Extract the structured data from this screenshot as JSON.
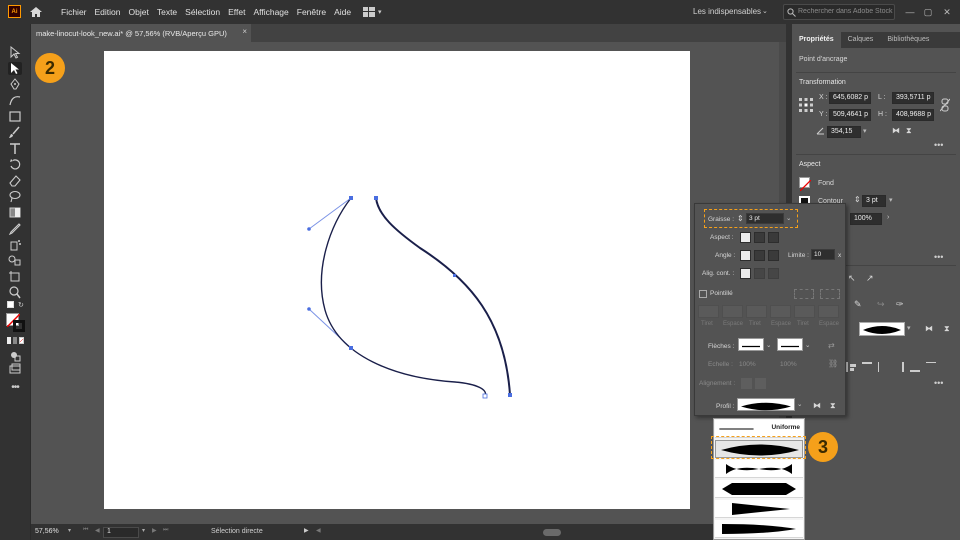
{
  "app": {
    "logo": "Ai"
  },
  "menu": [
    "Fichier",
    "Edition",
    "Objet",
    "Texte",
    "Sélection",
    "Effet",
    "Affichage",
    "Fenêtre",
    "Aide"
  ],
  "workspace": {
    "label": "Les indispensables"
  },
  "search": {
    "placeholder": "Rechercher dans Adobe Stock"
  },
  "document": {
    "tab_title": "make-linocut-look_new.ai* @ 57,56% (RVB/Aperçu GPU)",
    "close": "×"
  },
  "status": {
    "zoom": "57,56%",
    "page": "1",
    "tool_name": "Sélection directe"
  },
  "panel": {
    "tabs": [
      "Propriétés",
      "Calques",
      "Bibliothèques"
    ],
    "context": "Point d'ancrage",
    "transformation": {
      "heading": "Transformation",
      "x_label": "X :",
      "x_value": "645,6082 p",
      "y_label": "Y :",
      "y_value": "509,4641 p",
      "l_label": "L :",
      "l_value": "393,5711 p",
      "h_label": "H :",
      "h_value": "408,9688 p",
      "angle_value": "354,15"
    },
    "aspect": {
      "heading": "Aspect",
      "fill_label": "Fond",
      "stroke_label": "Contour",
      "stroke_value": "3 pt",
      "opacity_value": "100%"
    }
  },
  "stroke_panel": {
    "weight_label": "Graisse :",
    "weight_value": "3 pt",
    "cap_label": "Aspect :",
    "corner_label": "Angle :",
    "limit_label": "Limite :",
    "limit_value": "10",
    "limit_unit": "x",
    "align_label": "Alig. cont. :",
    "dashed_label": "Pointillé",
    "dash_cells": [
      "Tiret",
      "Espace",
      "Tiret",
      "Espace",
      "Tiret",
      "Espace"
    ],
    "arrows_label": "Flèches :",
    "scale_label": "Echelle :",
    "scale_a": "100%",
    "scale_b": "100%",
    "alignment_label": "Alignement :",
    "profile_label": "Profil :"
  },
  "profiles": {
    "uniform_label": "Uniforme"
  },
  "callouts": {
    "left": "2",
    "right": "3"
  },
  "colors": {
    "accent": "#f5a01a",
    "path": "#1a1f4a",
    "anchor": "#4a6ee0"
  }
}
